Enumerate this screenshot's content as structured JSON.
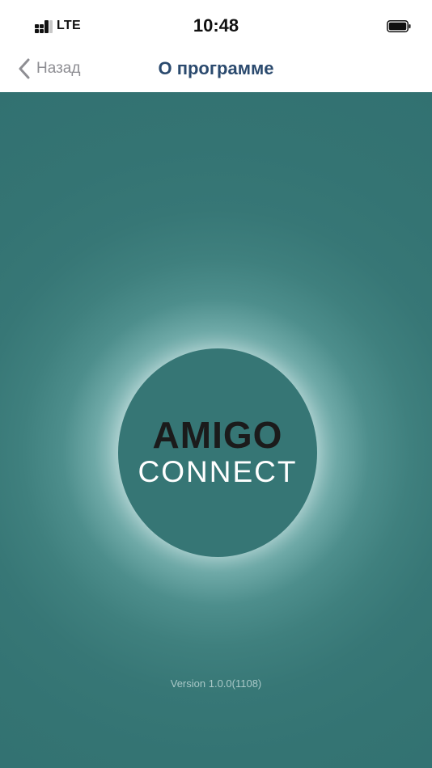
{
  "status_bar": {
    "network": "LTE",
    "time": "10:48"
  },
  "nav": {
    "back_label": "Назад",
    "title": "О программе"
  },
  "logo": {
    "line1": "AMIGO",
    "line2": "CONNECT"
  },
  "version": "Version 1.0.0(1108)",
  "colors": {
    "accent": "#2b4a6e",
    "background_teal": "#347473",
    "circle": "#367675"
  },
  "icons": {
    "signal": "signal-bars-icon",
    "battery": "battery-full-icon",
    "back": "chevron-left-icon"
  }
}
